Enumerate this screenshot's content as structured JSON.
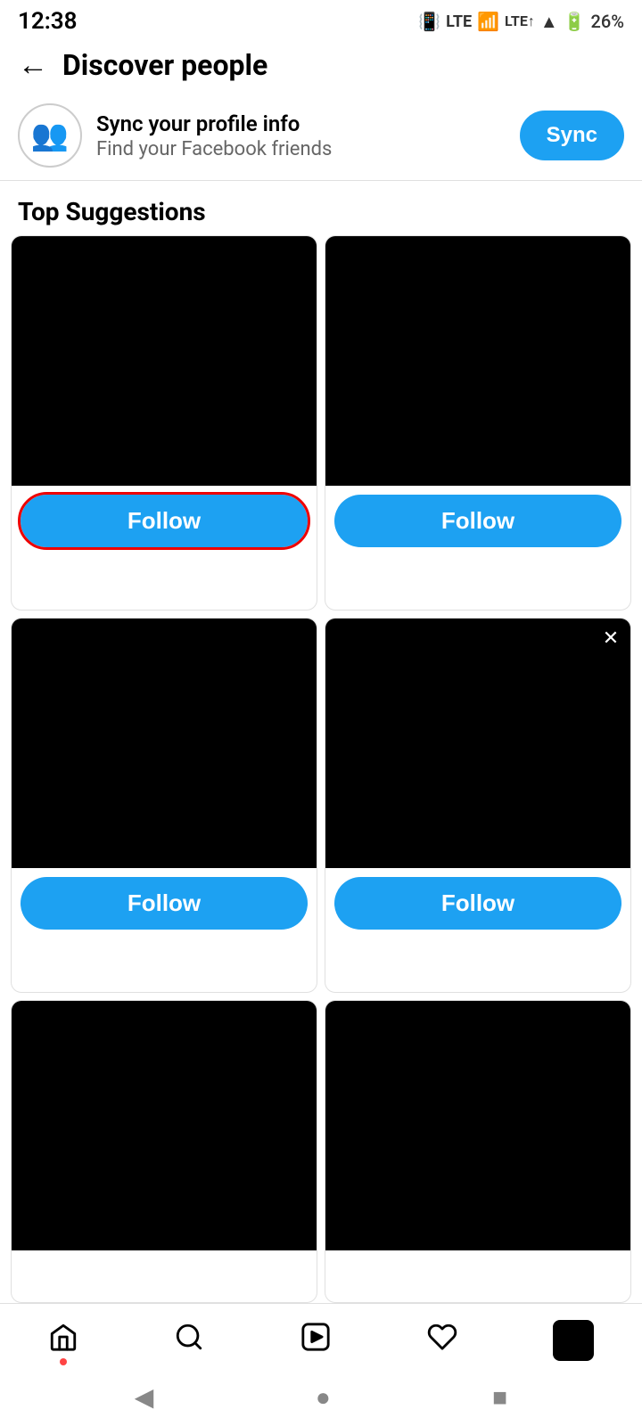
{
  "statusBar": {
    "time": "12:38",
    "battery": "26%"
  },
  "header": {
    "title": "Discover people",
    "backLabel": "←"
  },
  "syncBanner": {
    "title": "Sync your profile info",
    "subtitle": "Find your Facebook friends",
    "buttonLabel": "Sync"
  },
  "sectionTitle": "Top Suggestions",
  "suggestions": [
    {
      "id": 1,
      "followLabel": "Follow",
      "highlighted": true,
      "hasClose": false
    },
    {
      "id": 2,
      "followLabel": "Follow",
      "highlighted": false,
      "hasClose": false
    },
    {
      "id": 3,
      "followLabel": "Follow",
      "highlighted": false,
      "hasClose": false
    },
    {
      "id": 4,
      "followLabel": "Follow",
      "highlighted": false,
      "hasClose": true
    },
    {
      "id": 5,
      "followLabel": "",
      "highlighted": false,
      "hasClose": false
    },
    {
      "id": 6,
      "followLabel": "",
      "highlighted": false,
      "hasClose": false
    }
  ],
  "bottomNav": {
    "items": [
      {
        "name": "home",
        "icon": "⌂",
        "hasDot": true
      },
      {
        "name": "search",
        "icon": "🔍",
        "hasDot": false
      },
      {
        "name": "reels",
        "icon": "▶",
        "hasDot": false
      },
      {
        "name": "heart",
        "icon": "♡",
        "hasDot": false
      }
    ]
  },
  "systemNav": {
    "back": "◀",
    "home": "●",
    "recents": "■"
  }
}
